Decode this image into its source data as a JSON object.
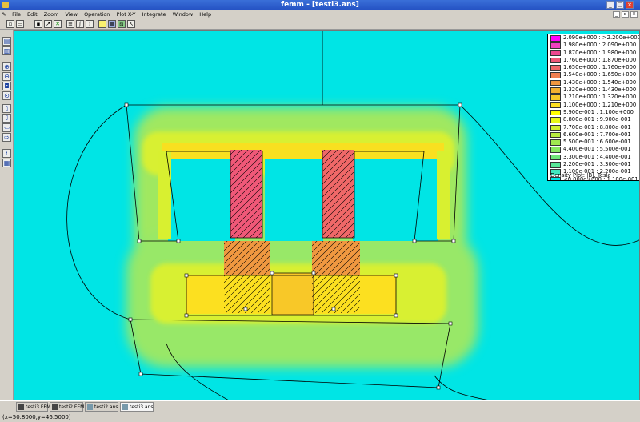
{
  "window": {
    "title": "femm - [testi3.ans]",
    "minimize": "_",
    "maximize": "□",
    "close": "×"
  },
  "menu": {
    "items": [
      "File",
      "Edit",
      "Zoom",
      "View",
      "Operation",
      "Plot X-Y",
      "Integrate",
      "Window",
      "Help"
    ]
  },
  "legend": {
    "rows": [
      {
        "label": "2.090e+000 : >2.200e+000",
        "color": "#ff00ff"
      },
      {
        "label": "1.980e+000 : 2.090e+000",
        "color": "#f040c0"
      },
      {
        "label": "1.870e+000 : 1.980e+000",
        "color": "#f04890"
      },
      {
        "label": "1.760e+000 : 1.870e+000",
        "color": "#f05878"
      },
      {
        "label": "1.650e+000 : 1.760e+000",
        "color": "#f06868"
      },
      {
        "label": "1.540e+000 : 1.650e+000",
        "color": "#f08050"
      },
      {
        "label": "1.430e+000 : 1.540e+000",
        "color": "#f09840"
      },
      {
        "label": "1.320e+000 : 1.430e+000",
        "color": "#f4b030"
      },
      {
        "label": "1.210e+000 : 1.320e+000",
        "color": "#f8c828"
      },
      {
        "label": "1.100e+000 : 1.210e+000",
        "color": "#fce020"
      },
      {
        "label": "9.900e-001 : 1.100e+000",
        "color": "#ffff00"
      },
      {
        "label": "8.800e-001 : 9.900e-001",
        "color": "#e8f818"
      },
      {
        "label": "7.700e-001 : 8.800e-001",
        "color": "#d0f030"
      },
      {
        "label": "6.600e-001 : 7.700e-001",
        "color": "#b8ec40"
      },
      {
        "label": "5.500e-001 : 6.600e-001",
        "color": "#a0e850"
      },
      {
        "label": "4.400e-001 : 5.500e-001",
        "color": "#88e860"
      },
      {
        "label": "3.300e-001 : 4.400e-001",
        "color": "#70e878"
      },
      {
        "label": "2.200e-001 : 3.300e-001",
        "color": "#58e898"
      },
      {
        "label": "1.100e-001 : 2.200e-001",
        "color": "#40e8c0"
      },
      {
        "label": "<0.000e+000 : 1.100e-001",
        "color": "#00e5e5"
      }
    ],
    "caption": "Density Plot: |B|, Tesla"
  },
  "tabs": [
    {
      "label": "testi3.FEM",
      "active": false
    },
    {
      "label": "testi2.FEM",
      "active": false
    },
    {
      "label": "testi2.ans",
      "active": false
    },
    {
      "label": "testi3.ans",
      "active": true
    }
  ],
  "status": {
    "coords": "(x=50.8000,y=46.5000)"
  },
  "colors": {
    "background_field": "#00e5e5",
    "core_low": "#b8ec40",
    "core_mid": "#ffff00",
    "core_high": "#f05878"
  }
}
